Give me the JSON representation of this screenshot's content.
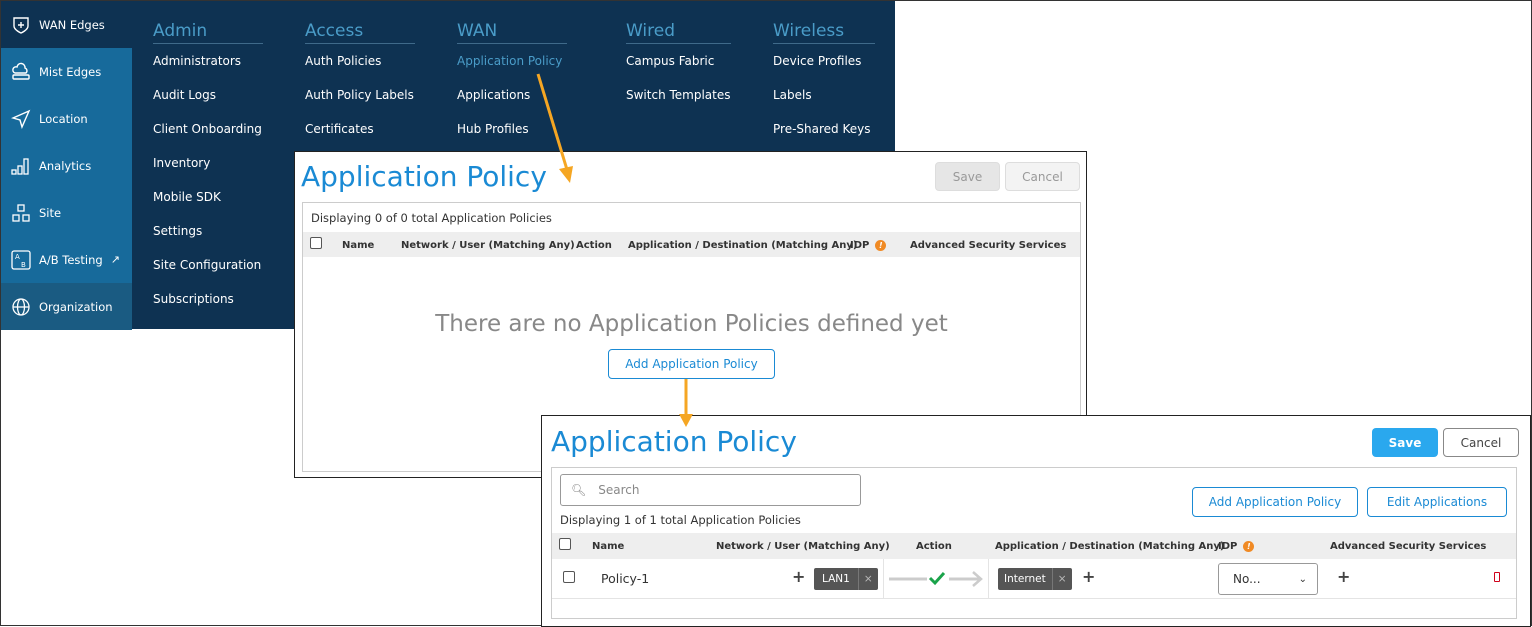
{
  "sidebar": {
    "items": [
      {
        "label": "WAN Edges",
        "icon": "shield-plus-icon"
      },
      {
        "label": "Mist Edges",
        "icon": "cloud-icon"
      },
      {
        "label": "Location",
        "icon": "navigation-icon"
      },
      {
        "label": "Analytics",
        "icon": "bar-chart-icon"
      },
      {
        "label": "Site",
        "icon": "site-icon"
      },
      {
        "label": "A/B Testing",
        "icon": "ab-testing-icon"
      },
      {
        "label": "Organization",
        "icon": "globe-icon"
      }
    ]
  },
  "menu": {
    "columns": [
      {
        "title": "Admin",
        "items": [
          "Administrators",
          "Audit Logs",
          "Client Onboarding",
          "Inventory",
          "Mobile SDK",
          "Settings",
          "Site Configuration",
          "Subscriptions"
        ]
      },
      {
        "title": "Access",
        "items": [
          "Auth Policies",
          "Auth Policy Labels",
          "Certificates"
        ]
      },
      {
        "title": "WAN",
        "items": [
          "Application Policy",
          "Applications",
          "Hub Profiles"
        ]
      },
      {
        "title": "Wired",
        "items": [
          "Campus Fabric",
          "Switch Templates"
        ]
      },
      {
        "title": "Wireless",
        "items": [
          "Device Profiles",
          "Labels",
          "Pre-Shared Keys"
        ]
      }
    ]
  },
  "panel1": {
    "title": "Application Policy",
    "save": "Save",
    "cancel": "Cancel",
    "count": "Displaying 0 of 0 total Application Policies",
    "columns": [
      "Name",
      "Network / User (Matching Any)",
      "Action",
      "Application / Destination (Matching Any)",
      "IDP",
      "Advanced Security Services"
    ],
    "empty": "There are no Application Policies defined yet",
    "add": "Add Application Policy"
  },
  "panel2": {
    "title": "Application Policy",
    "save": "Save",
    "cancel": "Cancel",
    "search_placeholder": "Search",
    "add": "Add Application Policy",
    "edit": "Edit Applications",
    "count": "Displaying 1 of 1 total Application Policies",
    "columns": [
      "Name",
      "Network / User (Matching Any)",
      "Action",
      "Application / Destination (Matching Any)",
      "IDP",
      "Advanced Security Services"
    ],
    "rows": [
      {
        "name": "Policy-1",
        "network": "LAN1",
        "destination": "Internet",
        "idp": "No..."
      }
    ]
  },
  "colors": {
    "accent": "#1a8ad4",
    "arrow": "#f5a623",
    "menu_bg": "#0e3252",
    "sidebar": "#176a9b"
  }
}
